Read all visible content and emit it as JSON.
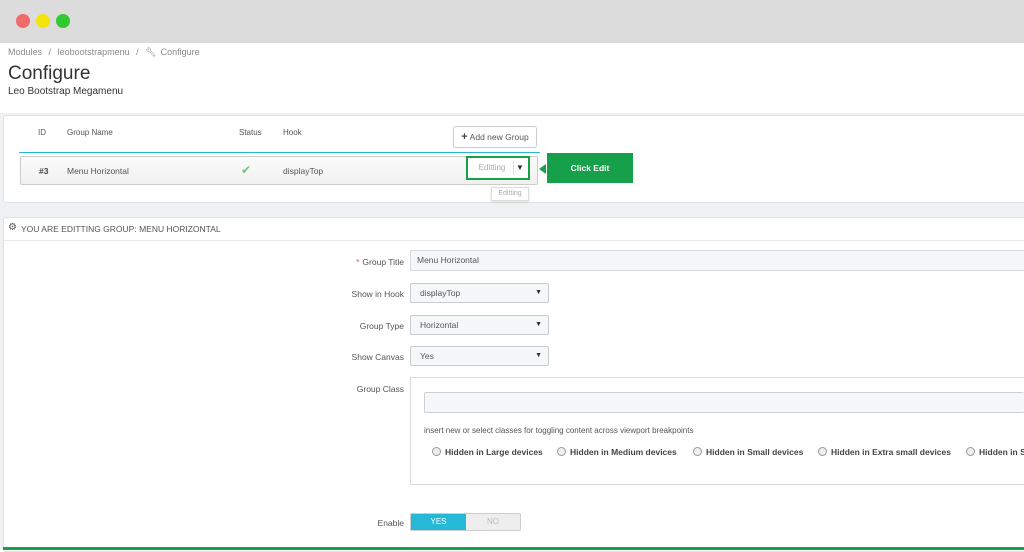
{
  "breadcrumb": {
    "modules": "Modules",
    "sep1": "/",
    "module": "leobootstrapmenu",
    "sep2": "/",
    "configure_icon": "wrench-icon",
    "configure": "Configure"
  },
  "page": {
    "title": "Configure",
    "subtitle": "Leo Bootstrap Megamenu"
  },
  "groups_table": {
    "headers": {
      "id": "ID",
      "name": "Group Name",
      "status": "Status",
      "hook": "Hook"
    },
    "add_button": {
      "icon": "plus-icon",
      "label": "Add new Group"
    },
    "rows": [
      {
        "id": "#3",
        "name": "Menu Horizontal",
        "status_icon": "check-icon",
        "hook": "displayTop",
        "edit_label": "Editting",
        "tooltip": "Editting"
      }
    ]
  },
  "annotation": {
    "callout": "Click Edit",
    "color": "#17a04a"
  },
  "edit_panel": {
    "title_icon": "gears-icon",
    "title": "YOU ARE EDITTING GROUP: MENU HORIZONTAL",
    "fields": {
      "group_title": {
        "label": "Group Title",
        "required_mark": "*",
        "value": "Menu Horizontal"
      },
      "show_in_hook": {
        "label": "Show in Hook",
        "value": "displayTop"
      },
      "group_type": {
        "label": "Group Type",
        "value": "Horizontal"
      },
      "show_canvas": {
        "label": "Show Canvas",
        "value": "Yes"
      },
      "group_class": {
        "label": "Group Class",
        "value": "",
        "help": "insert new or select classes for toggling content across viewport breakpoints",
        "options": [
          "Hidden in Large devices",
          "Hidden in Medium devices",
          "Hidden in Small devices",
          "Hidden in Extra small devices",
          "Hidden in S"
        ]
      },
      "enable": {
        "label": "Enable",
        "yes": "YES",
        "no": "NO",
        "selected": "YES"
      }
    }
  },
  "colors": {
    "accent": "#25b9d7",
    "highlight": "#17a04a",
    "check": "#72c279",
    "required": "#e05454"
  }
}
